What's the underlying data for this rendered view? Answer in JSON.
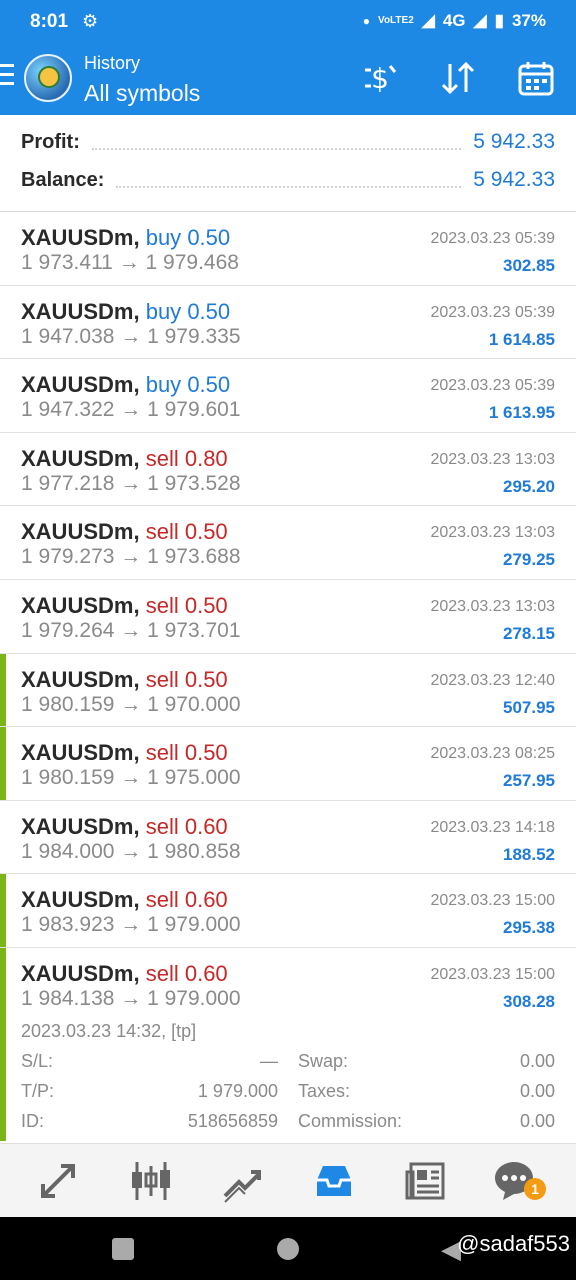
{
  "status_bar": {
    "time": "8:01",
    "network": "4G",
    "volte": "VoLTE2",
    "battery": "37%"
  },
  "header": {
    "subtitle": "History",
    "title": "All symbols",
    "icons": [
      "deposit-icon",
      "sort-icon",
      "calendar-icon"
    ]
  },
  "summary": {
    "profit_label": "Profit:",
    "profit_value": "5 942.33",
    "balance_label": "Balance:",
    "balance_value": "5 942.33"
  },
  "trades": [
    {
      "symbol": "XAUUSDm,",
      "side": "buy",
      "volume": "0.50",
      "open": "1 973.411",
      "close": "1 979.468",
      "date": "2023.03.23 05:39",
      "profit": "302.85",
      "marked": false
    },
    {
      "symbol": "XAUUSDm,",
      "side": "buy",
      "volume": "0.50",
      "open": "1 947.038",
      "close": "1 979.335",
      "date": "2023.03.23 05:39",
      "profit": "1 614.85",
      "marked": false
    },
    {
      "symbol": "XAUUSDm,",
      "side": "buy",
      "volume": "0.50",
      "open": "1 947.322",
      "close": "1 979.601",
      "date": "2023.03.23 05:39",
      "profit": "1 613.95",
      "marked": false
    },
    {
      "symbol": "XAUUSDm,",
      "side": "sell",
      "volume": "0.80",
      "open": "1 977.218",
      "close": "1 973.528",
      "date": "2023.03.23 13:03",
      "profit": "295.20",
      "marked": false
    },
    {
      "symbol": "XAUUSDm,",
      "side": "sell",
      "volume": "0.50",
      "open": "1 979.273",
      "close": "1 973.688",
      "date": "2023.03.23 13:03",
      "profit": "279.25",
      "marked": false
    },
    {
      "symbol": "XAUUSDm,",
      "side": "sell",
      "volume": "0.50",
      "open": "1 979.264",
      "close": "1 973.701",
      "date": "2023.03.23 13:03",
      "profit": "278.15",
      "marked": false
    },
    {
      "symbol": "XAUUSDm,",
      "side": "sell",
      "volume": "0.50",
      "open": "1 980.159",
      "close": "1 970.000",
      "date": "2023.03.23 12:40",
      "profit": "507.95",
      "marked": true
    },
    {
      "symbol": "XAUUSDm,",
      "side": "sell",
      "volume": "0.50",
      "open": "1 980.159",
      "close": "1 975.000",
      "date": "2023.03.23 08:25",
      "profit": "257.95",
      "marked": true
    },
    {
      "symbol": "XAUUSDm,",
      "side": "sell",
      "volume": "0.60",
      "open": "1 984.000",
      "close": "1 980.858",
      "date": "2023.03.23 14:18",
      "profit": "188.52",
      "marked": false
    },
    {
      "symbol": "XAUUSDm,",
      "side": "sell",
      "volume": "0.60",
      "open": "1 983.923",
      "close": "1 979.000",
      "date": "2023.03.23 15:00",
      "profit": "295.38",
      "marked": true
    }
  ],
  "expanded_trade": {
    "symbol": "XAUUSDm,",
    "side": "sell",
    "volume": "0.60",
    "open": "1 984.138",
    "close": "1 979.000",
    "date": "2023.03.23 15:00",
    "profit": "308.28",
    "open_info": "2023.03.23 14:32, [tp]",
    "sl_label": "S/L:",
    "sl_value": "—",
    "tp_label": "T/P:",
    "tp_value": "1 979.000",
    "id_label": "ID:",
    "id_value": "518656859",
    "swap_label": "Swap:",
    "swap_value": "0.00",
    "taxes_label": "Taxes:",
    "taxes_value": "0.00",
    "commission_label": "Commission:",
    "commission_value": "0.00"
  },
  "bottom_nav": {
    "active": "history",
    "badge": "1"
  },
  "system_nav": {
    "watermark": "@sadaf553"
  },
  "colors": {
    "header_blue": "#1e88e5",
    "buy_blue": "#1f7ad8",
    "sell_red": "#c62828",
    "marker_green": "#7cb518"
  }
}
